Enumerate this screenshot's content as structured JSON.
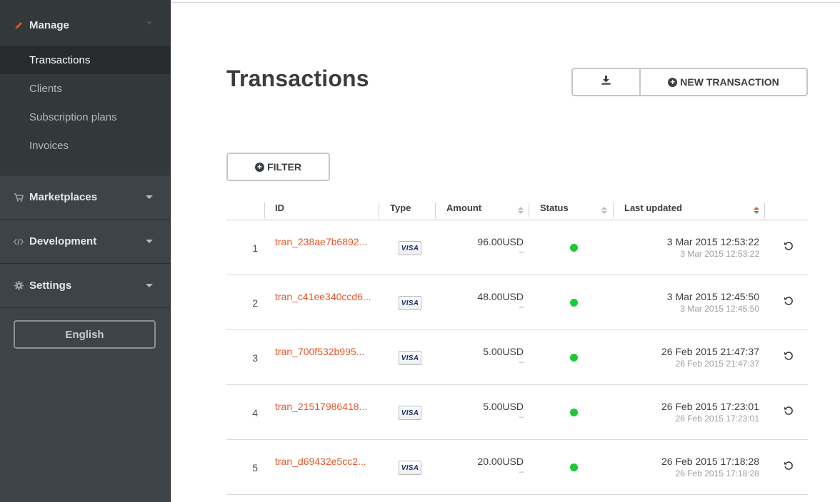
{
  "sidebar": {
    "manage": {
      "label": "Manage",
      "items": [
        {
          "label": "Transactions",
          "active": true
        },
        {
          "label": "Clients",
          "active": false
        },
        {
          "label": "Subscription plans",
          "active": false
        },
        {
          "label": "Invoices",
          "active": false
        }
      ]
    },
    "marketplaces": {
      "label": "Marketplaces",
      "icon": "cart-icon"
    },
    "development": {
      "label": "Development",
      "icon": "code-icon"
    },
    "settings": {
      "label": "Settings",
      "icon": "gear-icon"
    },
    "language_button": "English"
  },
  "main": {
    "title": "Transactions",
    "new_transaction_label": "NEW TRANSACTION",
    "filter_label": "FILTER"
  },
  "table": {
    "columns": {
      "id": "ID",
      "type": "Type",
      "amount": "Amount",
      "status": "Status",
      "last_updated": "Last updated"
    },
    "rows": [
      {
        "num": "1",
        "id": "tran_238ae7b6892...",
        "card": "VISA",
        "amount": "96.00USD",
        "amount_sub": "–",
        "status_color": "#1ec735",
        "date": "3 Mar 2015 12:53:22",
        "date_sub": "3 Mar 2015 12:53:22"
      },
      {
        "num": "2",
        "id": "tran_c41ee340ccd6...",
        "card": "VISA",
        "amount": "48.00USD",
        "amount_sub": "–",
        "status_color": "#1ec735",
        "date": "3 Mar 2015 12:45:50",
        "date_sub": "3 Mar 2015 12:45:50"
      },
      {
        "num": "3",
        "id": "tran_700f532b995...",
        "card": "VISA",
        "amount": "5.00USD",
        "amount_sub": "–",
        "status_color": "#1ec735",
        "date": "26 Feb 2015 21:47:37",
        "date_sub": "26 Feb 2015 21:47:37"
      },
      {
        "num": "4",
        "id": "tran_21517986418...",
        "card": "VISA",
        "amount": "5.00USD",
        "amount_sub": "–",
        "status_color": "#1ec735",
        "date": "26 Feb 2015 17:23:01",
        "date_sub": "26 Feb 2015 17:23:01"
      },
      {
        "num": "5",
        "id": "tran_d69432e5cc2...",
        "card": "VISA",
        "amount": "20.00USD",
        "amount_sub": "–",
        "status_color": "#1ec735",
        "date": "26 Feb 2015 17:18:28",
        "date_sub": "26 Feb 2015 17:18:28"
      }
    ]
  },
  "colors": {
    "accent": "#e4562a",
    "status_ok": "#1ec735",
    "sidebar_bg": "#3d4346"
  }
}
